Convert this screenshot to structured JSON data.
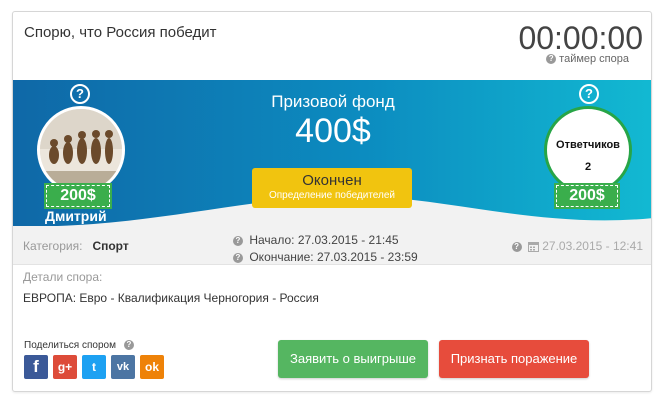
{
  "bet": {
    "title": "Спорю, что Россия победит",
    "timer": "00:00:00",
    "timer_label": "таймер спора"
  },
  "banner": {
    "fund_label": "Призовой фонд",
    "fund_value": "400$",
    "status": "Окончен",
    "status_sub": "Определение победителей",
    "help_glyph": "?"
  },
  "creator": {
    "name": "Дмитрий",
    "amount": "200$"
  },
  "responders": {
    "label": "Ответчиков",
    "count": "2",
    "amount": "200$"
  },
  "info": {
    "category_label": "Категория:",
    "category_value": "Спорт",
    "start": "Начало: 27.03.2015 - 21:45",
    "end": "Окончание: 27.03.2015 - 23:59",
    "published": "27.03.2015 - 12:41"
  },
  "details": {
    "label": "Детали спора:",
    "text": "ЕВРОПА: Евро - Квалификация Черногория - Россия"
  },
  "share": {
    "label": "Поделиться спором",
    "networks": [
      "f",
      "g+",
      "t",
      "vk",
      "ok"
    ]
  },
  "actions": {
    "claim_win": "Заявить о выигрыше",
    "admit_loss": "Признать поражение"
  },
  "colors": {
    "banner_start": "#0f68a7",
    "banner_end": "#12b9d2",
    "status": "#f1c40f",
    "win": "#55b661",
    "lose": "#e74c3c",
    "badge": "#3aae4c"
  },
  "icons": {
    "help": "question-circle-icon",
    "calendar": "calendar-icon"
  }
}
